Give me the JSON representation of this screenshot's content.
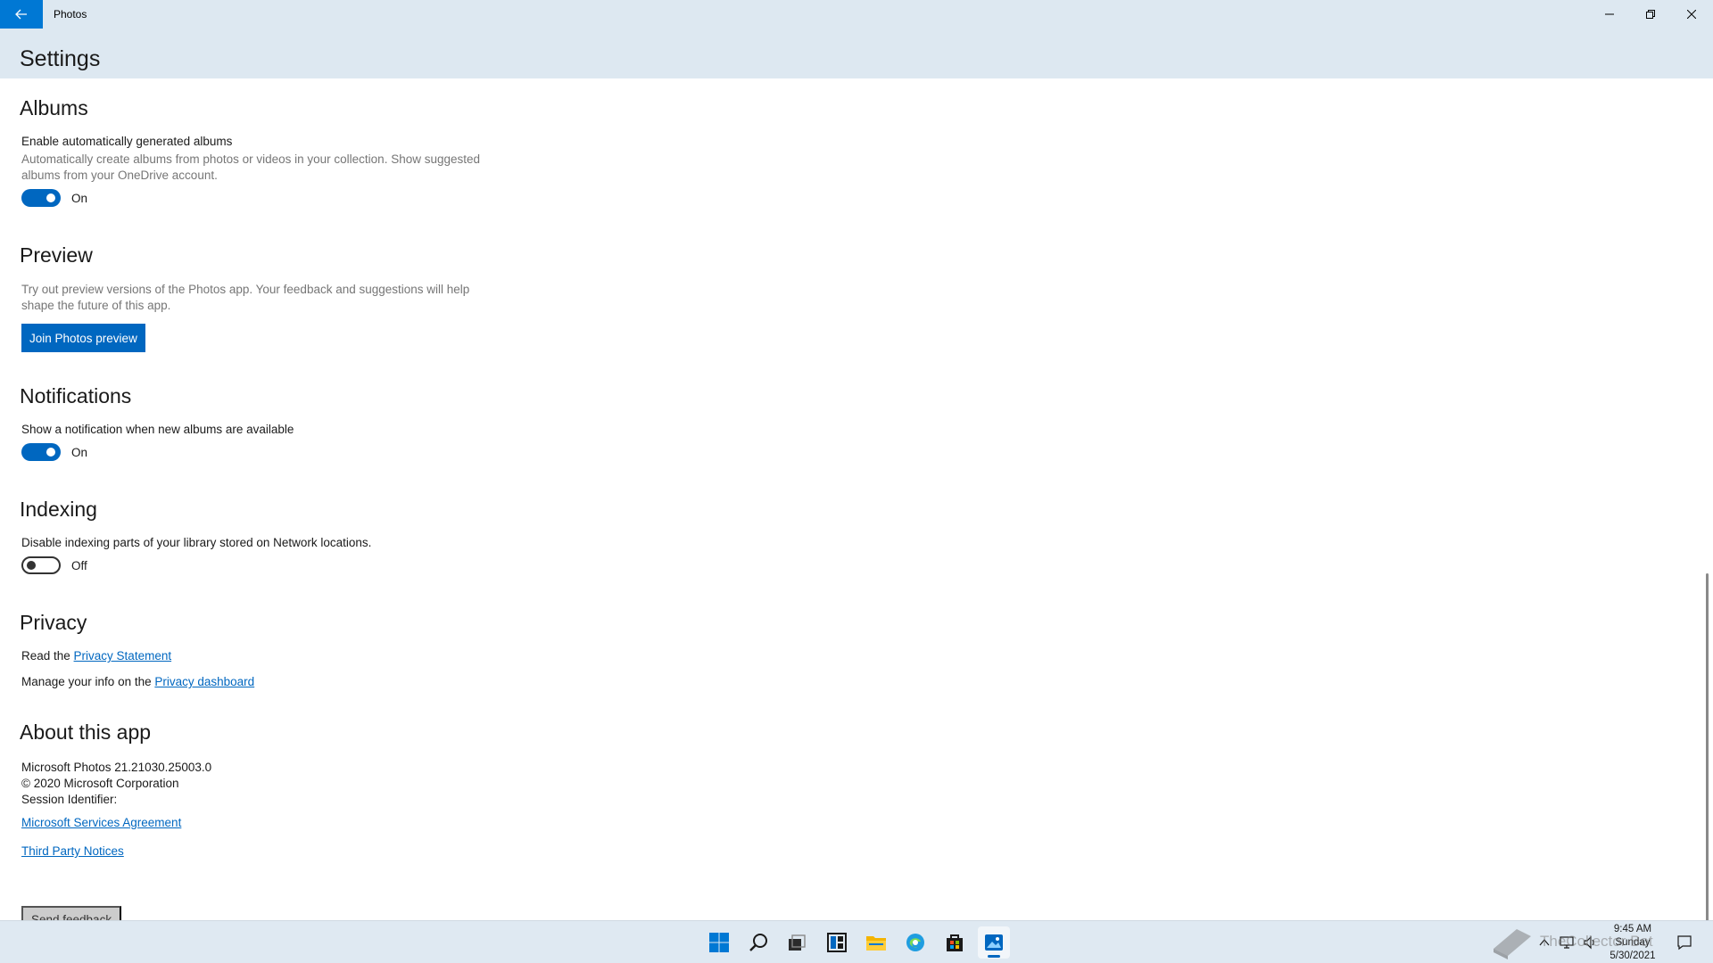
{
  "window": {
    "app_title": "Photos",
    "page_title": "Settings"
  },
  "albums": {
    "title": "Albums",
    "label": "Enable automatically generated albums",
    "description": "Automatically create albums from photos or videos in your collection. Show suggested albums from your OneDrive account.",
    "toggle_state": "On"
  },
  "preview": {
    "title": "Preview",
    "description": "Try out preview versions of the Photos app. Your feedback and suggestions will help shape the future of this app.",
    "button_label": "Join Photos preview"
  },
  "notifications": {
    "title": "Notifications",
    "label": "Show a notification when new albums are available",
    "toggle_state": "On"
  },
  "indexing": {
    "title": "Indexing",
    "label": "Disable indexing parts of your library stored on Network locations.",
    "toggle_state": "Off"
  },
  "privacy": {
    "title": "Privacy",
    "line1_prefix": "Read the ",
    "line1_link": "Privacy Statement",
    "line2_prefix": "Manage your info on the ",
    "line2_link": "Privacy dashboard"
  },
  "about": {
    "title": "About this app",
    "version": "Microsoft Photos 21.21030.25003.0",
    "copyright": "© 2020 Microsoft Corporation",
    "session": "Session Identifier:",
    "link1": "Microsoft Services Agreement",
    "link2": "Third Party Notices",
    "feedback_button": "Send feedback"
  },
  "taskbar": {
    "icons": [
      "start-icon",
      "search-icon",
      "task-view-icon",
      "widgets-icon",
      "file-explorer-icon",
      "edge-icon",
      "store-icon",
      "photos-icon"
    ],
    "time": "9:45 AM",
    "day": "Sunday",
    "date": "5/30/2021",
    "watermark": "TheCollector Bot"
  },
  "colors": {
    "accent": "#0067c0",
    "titlebar": "#dde8f1",
    "taskbar": "#dfe9f2"
  }
}
